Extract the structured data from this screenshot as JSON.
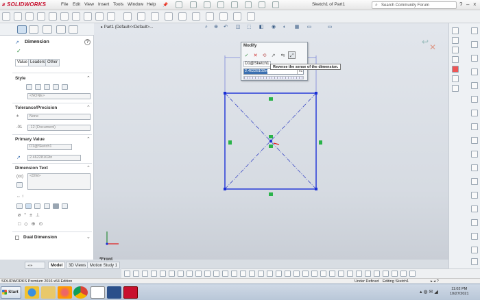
{
  "app": {
    "logo_brand": "SOLIDWORKS",
    "document_title": "Sketch1 of Part1"
  },
  "menu": [
    "File",
    "Edit",
    "View",
    "Insert",
    "Tools",
    "Window",
    "Help"
  ],
  "search": {
    "placeholder": "Search Community Forum"
  },
  "property_manager": {
    "title": "Dimension",
    "tabs": [
      "Value",
      "Leaders",
      "Other"
    ],
    "style_section": "Style",
    "style_value": "<NONE>",
    "tolerance_section": "Tolerance/Precision",
    "tolerance_type": "None",
    "precision_value": ".12 (Document)",
    "primary_value_section": "Primary Value",
    "primary_name": "D1@Sketch1",
    "primary_value": "2.46228102in",
    "dimension_text_section": "Dimension Text",
    "dimension_text_value": "<DIM>",
    "dual_dimension": "Dual Dimension"
  },
  "bottom_tabs": [
    "Model",
    "3D Views",
    "Motion Study 1"
  ],
  "breadcrumb": "Part1 (Default<<Default>...",
  "modify_dialog": {
    "title": "Modify",
    "name": "D1@Sketch1",
    "value": "2.46228102in",
    "spin": "±1",
    "tooltip": "Reverse the sense of the dimension."
  },
  "view_label": "*Front",
  "status_bar": {
    "left": "SOLIDWORKS Premium 2016 x64 Edition",
    "status": "Under Defined",
    "editing": "Editing Sketch1"
  },
  "taskbar": {
    "start": "Start",
    "time": "11:02 PM",
    "date": "10/27/2021"
  },
  "colors": {
    "sketch_blue": "#1a2fd6",
    "center_line": "#4a57c8",
    "relation_green": "#2ab34a",
    "accent_red": "#c8102e"
  }
}
